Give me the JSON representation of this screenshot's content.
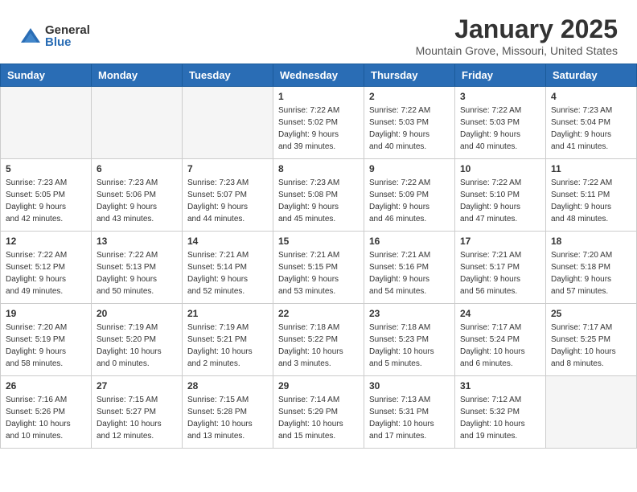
{
  "logo": {
    "general": "General",
    "blue": "Blue"
  },
  "header": {
    "month": "January 2025",
    "location": "Mountain Grove, Missouri, United States"
  },
  "days_of_week": [
    "Sunday",
    "Monday",
    "Tuesday",
    "Wednesday",
    "Thursday",
    "Friday",
    "Saturday"
  ],
  "weeks": [
    [
      {
        "day": "",
        "info": ""
      },
      {
        "day": "",
        "info": ""
      },
      {
        "day": "",
        "info": ""
      },
      {
        "day": "1",
        "info": "Sunrise: 7:22 AM\nSunset: 5:02 PM\nDaylight: 9 hours\nand 39 minutes."
      },
      {
        "day": "2",
        "info": "Sunrise: 7:22 AM\nSunset: 5:03 PM\nDaylight: 9 hours\nand 40 minutes."
      },
      {
        "day": "3",
        "info": "Sunrise: 7:22 AM\nSunset: 5:03 PM\nDaylight: 9 hours\nand 40 minutes."
      },
      {
        "day": "4",
        "info": "Sunrise: 7:23 AM\nSunset: 5:04 PM\nDaylight: 9 hours\nand 41 minutes."
      }
    ],
    [
      {
        "day": "5",
        "info": "Sunrise: 7:23 AM\nSunset: 5:05 PM\nDaylight: 9 hours\nand 42 minutes."
      },
      {
        "day": "6",
        "info": "Sunrise: 7:23 AM\nSunset: 5:06 PM\nDaylight: 9 hours\nand 43 minutes."
      },
      {
        "day": "7",
        "info": "Sunrise: 7:23 AM\nSunset: 5:07 PM\nDaylight: 9 hours\nand 44 minutes."
      },
      {
        "day": "8",
        "info": "Sunrise: 7:23 AM\nSunset: 5:08 PM\nDaylight: 9 hours\nand 45 minutes."
      },
      {
        "day": "9",
        "info": "Sunrise: 7:22 AM\nSunset: 5:09 PM\nDaylight: 9 hours\nand 46 minutes."
      },
      {
        "day": "10",
        "info": "Sunrise: 7:22 AM\nSunset: 5:10 PM\nDaylight: 9 hours\nand 47 minutes."
      },
      {
        "day": "11",
        "info": "Sunrise: 7:22 AM\nSunset: 5:11 PM\nDaylight: 9 hours\nand 48 minutes."
      }
    ],
    [
      {
        "day": "12",
        "info": "Sunrise: 7:22 AM\nSunset: 5:12 PM\nDaylight: 9 hours\nand 49 minutes."
      },
      {
        "day": "13",
        "info": "Sunrise: 7:22 AM\nSunset: 5:13 PM\nDaylight: 9 hours\nand 50 minutes."
      },
      {
        "day": "14",
        "info": "Sunrise: 7:21 AM\nSunset: 5:14 PM\nDaylight: 9 hours\nand 52 minutes."
      },
      {
        "day": "15",
        "info": "Sunrise: 7:21 AM\nSunset: 5:15 PM\nDaylight: 9 hours\nand 53 minutes."
      },
      {
        "day": "16",
        "info": "Sunrise: 7:21 AM\nSunset: 5:16 PM\nDaylight: 9 hours\nand 54 minutes."
      },
      {
        "day": "17",
        "info": "Sunrise: 7:21 AM\nSunset: 5:17 PM\nDaylight: 9 hours\nand 56 minutes."
      },
      {
        "day": "18",
        "info": "Sunrise: 7:20 AM\nSunset: 5:18 PM\nDaylight: 9 hours\nand 57 minutes."
      }
    ],
    [
      {
        "day": "19",
        "info": "Sunrise: 7:20 AM\nSunset: 5:19 PM\nDaylight: 9 hours\nand 58 minutes."
      },
      {
        "day": "20",
        "info": "Sunrise: 7:19 AM\nSunset: 5:20 PM\nDaylight: 10 hours\nand 0 minutes."
      },
      {
        "day": "21",
        "info": "Sunrise: 7:19 AM\nSunset: 5:21 PM\nDaylight: 10 hours\nand 2 minutes."
      },
      {
        "day": "22",
        "info": "Sunrise: 7:18 AM\nSunset: 5:22 PM\nDaylight: 10 hours\nand 3 minutes."
      },
      {
        "day": "23",
        "info": "Sunrise: 7:18 AM\nSunset: 5:23 PM\nDaylight: 10 hours\nand 5 minutes."
      },
      {
        "day": "24",
        "info": "Sunrise: 7:17 AM\nSunset: 5:24 PM\nDaylight: 10 hours\nand 6 minutes."
      },
      {
        "day": "25",
        "info": "Sunrise: 7:17 AM\nSunset: 5:25 PM\nDaylight: 10 hours\nand 8 minutes."
      }
    ],
    [
      {
        "day": "26",
        "info": "Sunrise: 7:16 AM\nSunset: 5:26 PM\nDaylight: 10 hours\nand 10 minutes."
      },
      {
        "day": "27",
        "info": "Sunrise: 7:15 AM\nSunset: 5:27 PM\nDaylight: 10 hours\nand 12 minutes."
      },
      {
        "day": "28",
        "info": "Sunrise: 7:15 AM\nSunset: 5:28 PM\nDaylight: 10 hours\nand 13 minutes."
      },
      {
        "day": "29",
        "info": "Sunrise: 7:14 AM\nSunset: 5:29 PM\nDaylight: 10 hours\nand 15 minutes."
      },
      {
        "day": "30",
        "info": "Sunrise: 7:13 AM\nSunset: 5:31 PM\nDaylight: 10 hours\nand 17 minutes."
      },
      {
        "day": "31",
        "info": "Sunrise: 7:12 AM\nSunset: 5:32 PM\nDaylight: 10 hours\nand 19 minutes."
      },
      {
        "day": "",
        "info": ""
      }
    ]
  ]
}
